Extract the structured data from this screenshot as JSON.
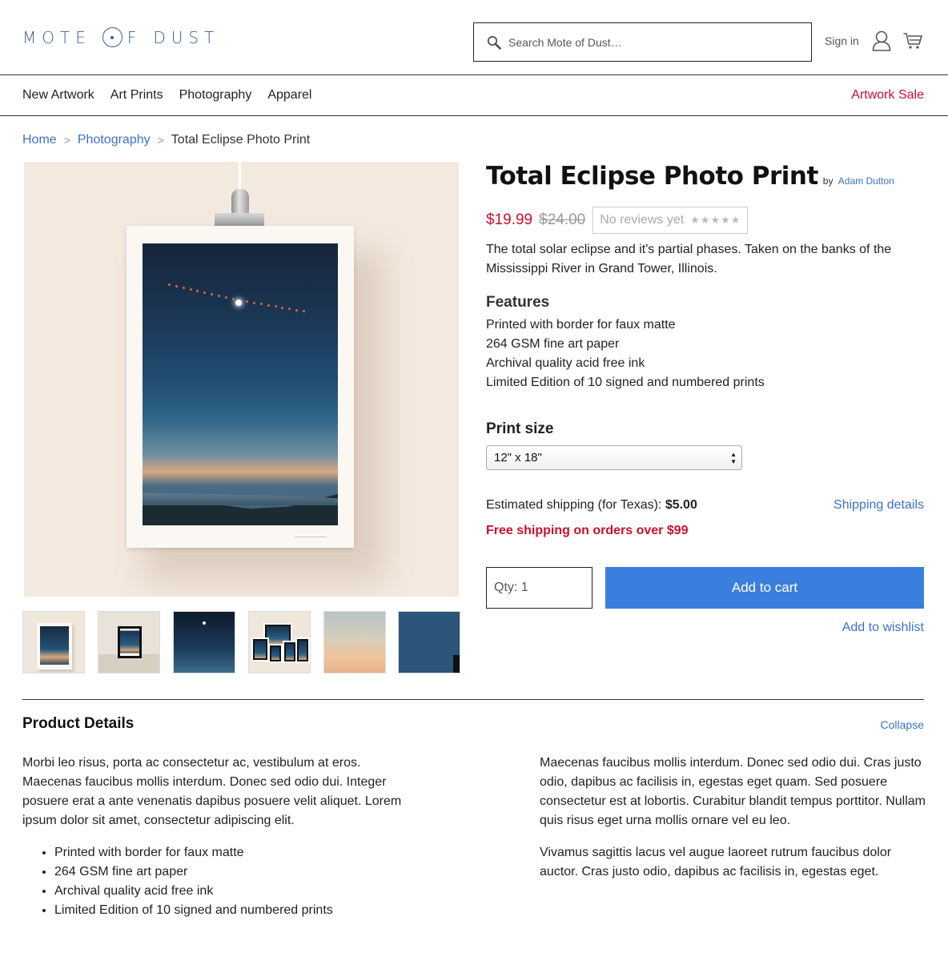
{
  "brand": {
    "logo_part1": "MOTE",
    "logo_part2": "F",
    "logo_part3": "DUST",
    "accent": "#3b5f8a"
  },
  "search": {
    "placeholder": "Search Mote of Dust…"
  },
  "account": {
    "signin": "Sign in"
  },
  "nav": {
    "items": [
      "New Artwork",
      "Art Prints",
      "Photography",
      "Apparel"
    ],
    "sale": "Artwork Sale",
    "sale_color": "#c8102e"
  },
  "breadcrumb": {
    "home": "Home",
    "category": "Photography",
    "current": "Total Eclipse Photo Print"
  },
  "product": {
    "title": "Total Eclipse Photo Print",
    "by": "by",
    "author": "Adam Dutton",
    "price": "$19.99",
    "old_price": "$24.00",
    "reviews": "No reviews yet",
    "rating": 0,
    "max_rating": 5,
    "description": "The total solar eclipse and it's partial phases. Taken on the banks of the Mississippi River in Grand Tower, Illinois.",
    "features_title": "Features",
    "features": [
      "Printed with border for faux matte",
      "264 GSM fine art paper",
      "Archival quality acid free ink",
      "Limited Edition of 10 signed and numbered prints"
    ],
    "size_label": "Print size",
    "size_selected": "12\" x 18\"",
    "shipping_text": "Estimated shipping (for Texas):",
    "shipping_amount": "$5.00",
    "shipping_details": "Shipping details",
    "free_shipping": "Free shipping on orders over $99",
    "qty_label": "Qty:",
    "qty_value": "1",
    "add_to_cart": "Add to cart",
    "add_to_wishlist": "Add to wishlist",
    "button_color": "#3a7fdd"
  },
  "details": {
    "title": "Product Details",
    "collapse": "Collapse",
    "left_paragraph": "Morbi leo risus, porta ac consectetur ac, vestibulum at eros. Maecenas faucibus mollis interdum. Donec sed odio dui. Integer posuere erat a ante venenatis dapibus posuere velit aliquet. Lorem ipsum dolor sit amet, consectetur adipiscing elit.",
    "bullets": [
      "Printed with border for faux matte",
      "264 GSM fine art paper",
      "Archival quality acid free ink",
      "Limited Edition of 10 signed and numbered prints"
    ],
    "right_paragraphs": [
      "Maecenas faucibus mollis interdum. Donec sed odio dui. Cras justo odio, dapibus ac facilisis in, egestas eget quam. Sed posuere consectetur est at lobortis. Curabitur blandit tempus porttitor. Nullam quis risus eget urna mollis ornare vel eu leo.",
      "Vivamus sagittis lacus vel augue laoreet rutrum faucibus dolor auctor. Cras justo odio, dapibus ac facilisis in, egestas eget."
    ]
  },
  "icons": {
    "search": "search-icon",
    "user": "user-icon",
    "cart": "cart-icon",
    "select": "chevron-updown-icon"
  }
}
